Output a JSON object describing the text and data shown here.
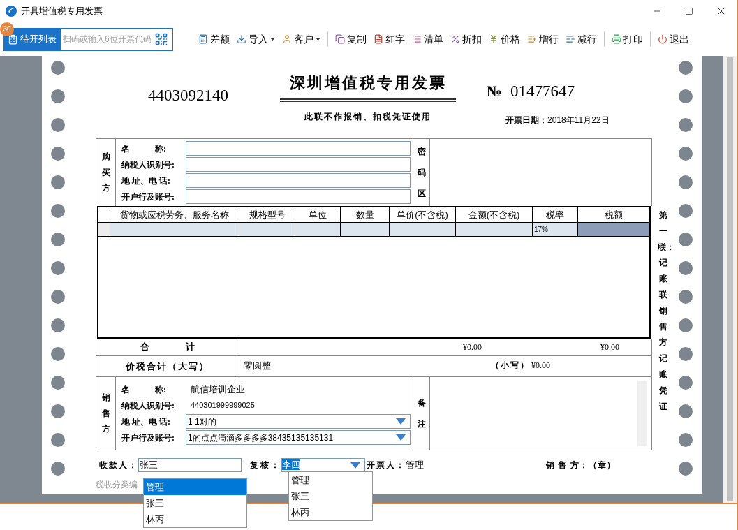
{
  "window": {
    "title": "开具增值税专用发票"
  },
  "toolbar": {
    "pending_button": {
      "label": "待开列表",
      "badge": "30"
    },
    "scan_field": {
      "placeholder": "扫码或输入6位开票代码"
    },
    "buttons": [
      {
        "label": "差额",
        "dropdown": false,
        "separator_before": false
      },
      {
        "label": "导入",
        "dropdown": true,
        "separator_before": false
      },
      {
        "label": "客户",
        "dropdown": true,
        "separator_before": false
      },
      {
        "label": "复制",
        "dropdown": false,
        "separator_before": true
      },
      {
        "label": "红字",
        "dropdown": false,
        "separator_before": false
      },
      {
        "label": "清单",
        "dropdown": false,
        "separator_before": false
      },
      {
        "label": "折扣",
        "dropdown": false,
        "separator_before": false
      },
      {
        "label": "价格",
        "dropdown": false,
        "separator_before": false
      },
      {
        "label": "增行",
        "dropdown": false,
        "separator_before": false
      },
      {
        "label": "减行",
        "dropdown": false,
        "separator_before": false
      },
      {
        "label": "打印",
        "dropdown": false,
        "separator_before": true
      },
      {
        "label": "退出",
        "dropdown": false,
        "separator_before": true
      }
    ]
  },
  "invoice": {
    "code": "4403092140",
    "title": "深圳增值税专用发票",
    "subtitle": "此联不作报销、扣税凭证使用",
    "number_sign": "№",
    "number": "01477647",
    "date_label": "开票日期：",
    "date": "2018年11月22日",
    "buyer": {
      "label": "购买方",
      "fields": [
        {
          "label": "名　　　称:"
        },
        {
          "label": "纳税人识别号:"
        },
        {
          "label": "地 址、电 话:"
        },
        {
          "label": "开户行及账号:"
        }
      ]
    },
    "cipher_label": "密码区",
    "items": {
      "columns": [
        "货物或应税劳务、服务名称",
        "规格型号",
        "单位",
        "数量",
        "单价(不含税)",
        "金额(不含税)",
        "税率",
        "税额"
      ],
      "rows": [
        {
          "tax_rate": "17%"
        }
      ]
    },
    "total": {
      "label": "合　　　　计",
      "amount": "¥0.00",
      "tax": "¥0.00"
    },
    "grand_total": {
      "label": "价税合计（大写）",
      "words": "零圆整",
      "figure_label": "（小写）",
      "figure": "¥0.00"
    },
    "seller": {
      "label": "销售方",
      "fields": [
        {
          "label": "名　　　称:",
          "value": "航信培训企业",
          "kind": "text"
        },
        {
          "label": "纳税人识别号:",
          "value": "440301999999025",
          "kind": "text"
        },
        {
          "label": "地 址、电 话:",
          "value": "1 1对的",
          "kind": "select"
        },
        {
          "label": "开户行及账号:",
          "value": "1的点点滴滴多多多多38435135135131",
          "kind": "select"
        }
      ]
    },
    "remarks_label": "备注",
    "copy_note": "第一联：记账联销售方记账凭证",
    "footer": {
      "payee": {
        "label": "收款人：",
        "value": "张三"
      },
      "reviewer": {
        "label": "复核：",
        "value": "李四",
        "value_highlighted": true
      },
      "issuer": {
        "label": "开票人：",
        "value": "管理"
      },
      "seller_stamp": "销 售 方：（章）",
      "tax_code_label": "税收分类编"
    },
    "dropdowns": [
      {
        "options": [
          {
            "label": "管理",
            "selected": true
          },
          {
            "label": "张三",
            "selected": false
          },
          {
            "label": "林丙",
            "selected": false
          }
        ]
      },
      {
        "options": [
          {
            "label": "管理",
            "selected": false
          },
          {
            "label": "张三",
            "selected": false
          },
          {
            "label": "林丙",
            "selected": false
          }
        ]
      }
    ]
  }
}
